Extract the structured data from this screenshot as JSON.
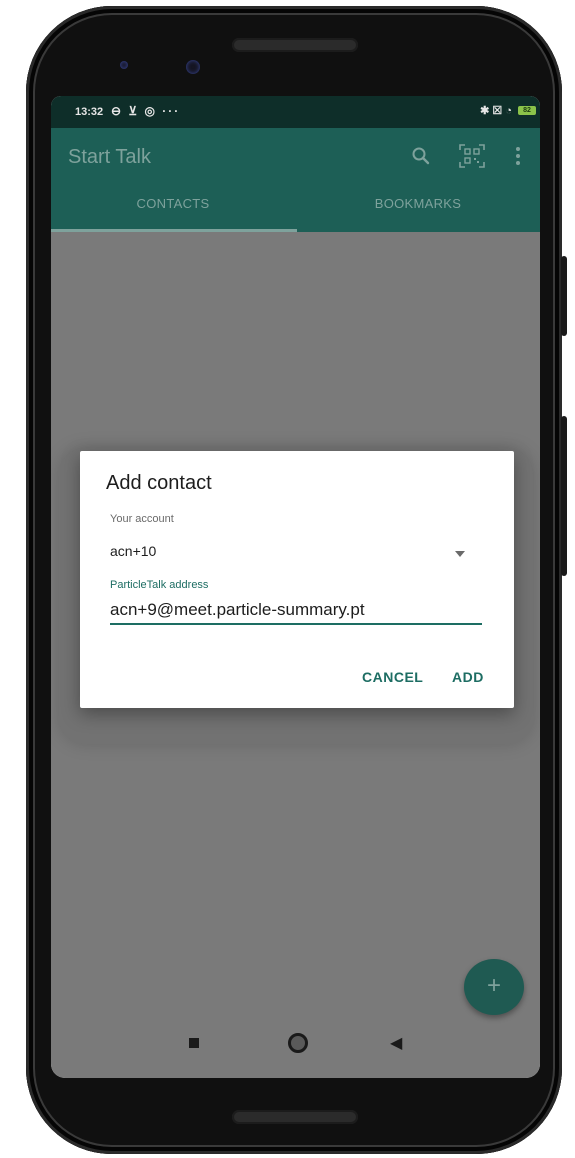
{
  "status_bar": {
    "time": "13:32",
    "left_symbols": "⊖ ⊻ ◎ ···",
    "right_symbols": "✱ ☒ ◔",
    "battery": "82"
  },
  "app_bar": {
    "title": "Start Talk",
    "icons": [
      "search-icon",
      "qr-code-icon",
      "more-vert-icon"
    ]
  },
  "tabs": [
    {
      "label": "CONTACTS",
      "selected": true
    },
    {
      "label": "BOOKMARKS",
      "selected": false
    }
  ],
  "dialog": {
    "title": "Add contact",
    "account_label": "Your account",
    "account_value": "acn+10",
    "address_label": "ParticleTalk address",
    "address_value": "acn+9@meet.particle-summary.pt",
    "cancel_label": "CANCEL",
    "add_label": "ADD"
  },
  "fab": {
    "label": "+"
  },
  "colors": {
    "primary": "#1d5f56",
    "accent": "#1d6d63",
    "status_bar": "#0e2e29",
    "scrim": "#7a7a7a"
  }
}
